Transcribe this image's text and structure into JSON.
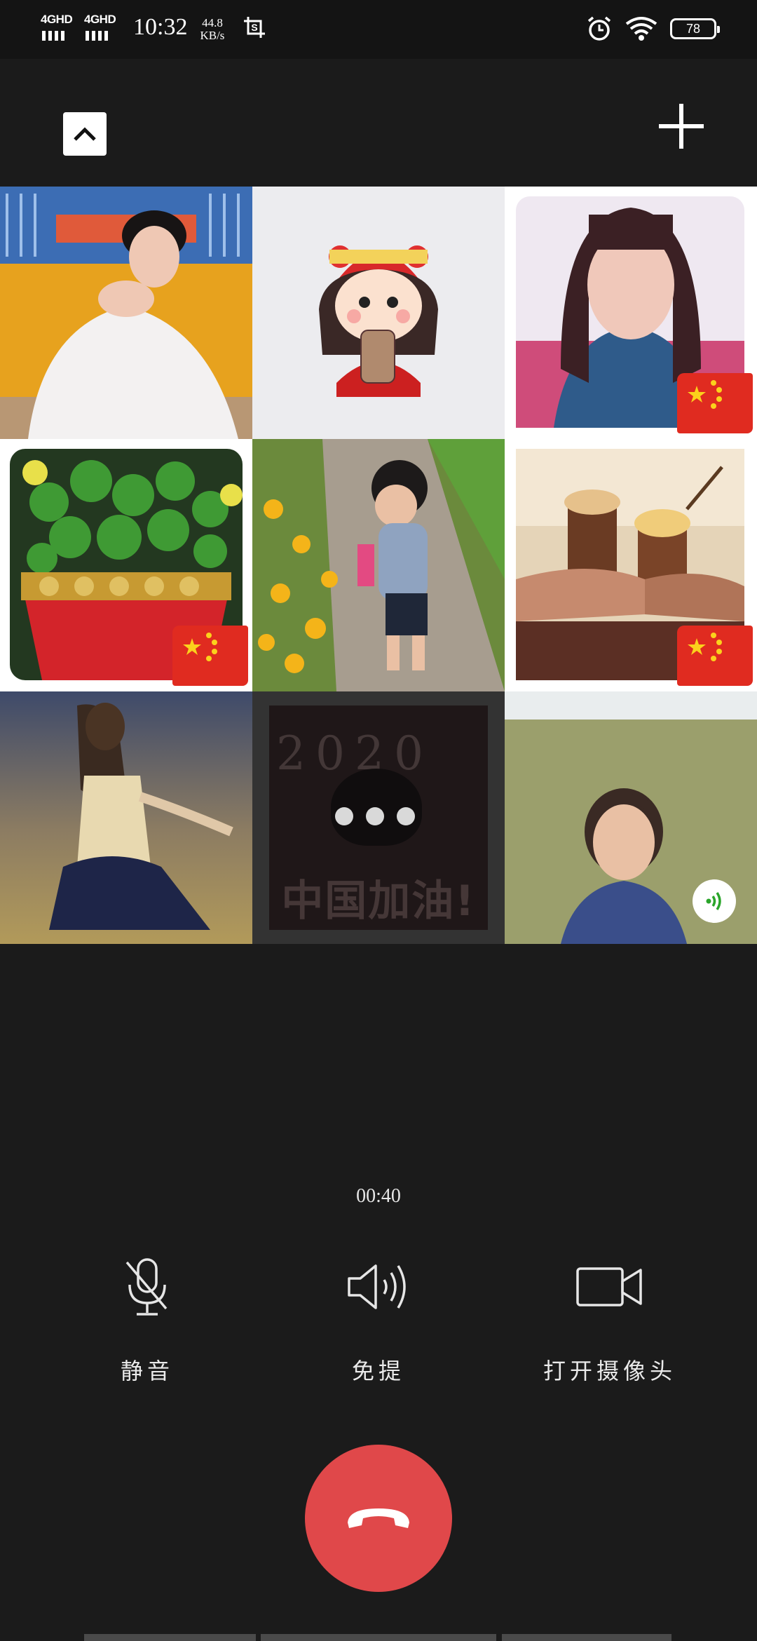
{
  "status_bar": {
    "network_1": "4GHD",
    "network_2": "4GHD",
    "time": "10:32",
    "speed_value": "44.8",
    "speed_unit": "KB/s",
    "battery": "78"
  },
  "call": {
    "timer": "00:40",
    "controls": {
      "mute_label": "静音",
      "speaker_label": "免提",
      "camera_label": "打开摄像头"
    }
  },
  "participants": [
    {
      "kind": "wedding-photo"
    },
    {
      "kind": "cartoon-girl-avatar"
    },
    {
      "kind": "woman-portrait",
      "badge": "china-flag"
    },
    {
      "kind": "money-plant-pot",
      "badge": "china-flag"
    },
    {
      "kind": "toddler-flowers"
    },
    {
      "kind": "holding-hands-drinks",
      "badge": "china-flag"
    },
    {
      "kind": "girl-dancing"
    },
    {
      "kind": "china-jiayou-poster",
      "connecting": true,
      "poster_year": "2020",
      "poster_text": "中国加油!"
    },
    {
      "kind": "woman-in-field",
      "badge": "speaking-indicator"
    }
  ],
  "colors": {
    "background": "#1b1b1b",
    "hangup": "#e0484a",
    "speaking": "#2aa52a",
    "flag": "#e02b20"
  }
}
